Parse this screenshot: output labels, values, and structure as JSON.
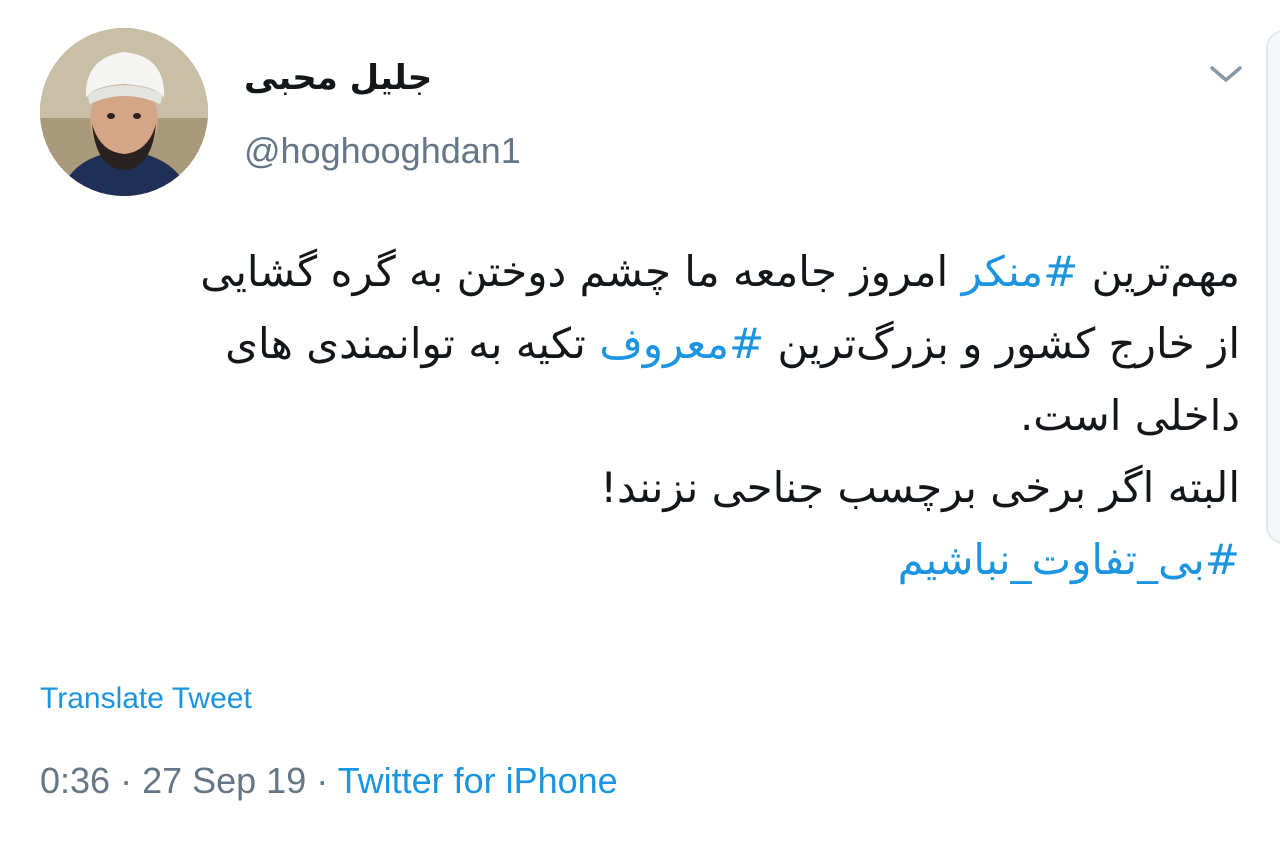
{
  "user": {
    "display_name": "جلیل محبی",
    "handle": "@hoghooghdan1"
  },
  "tweet": {
    "line1_text": "مهم‌ترین ",
    "line1_tag": "#منکر",
    "line1_rest": " امروز جامعه ما چشم دوختن به گره گشایی",
    "line2_text": "از خارج کشور و بزرگ‌ترین ",
    "line2_tag": "#معروف",
    "line2_rest": " تکیه به توانمندی های",
    "line3": "داخلی است.",
    "line4": "البته اگر برخی برچسب جناحی نزنند!",
    "line5_tag": "#بی_تفاوت_نباشیم"
  },
  "translate_label": "Translate Tweet",
  "meta": {
    "time": "0:36",
    "separator1": " · ",
    "date": "27 Sep 19",
    "separator2": " · ",
    "source": "Twitter for iPhone"
  },
  "colors": {
    "link": "#1b95e0",
    "text": "#14171a",
    "muted": "#657786"
  },
  "icons": {
    "menu": "chevron-down-icon"
  }
}
